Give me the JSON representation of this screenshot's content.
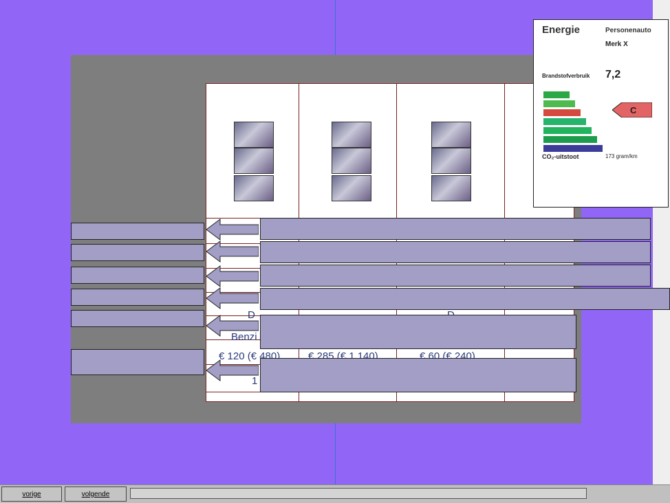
{
  "energy_label": {
    "title": "Energie",
    "category": "Personenauto",
    "brand": "Merk X",
    "efficiency_label": "Brandstofverbruik",
    "consumption": "7,2",
    "rating": "C",
    "co2_label": "CO₂-uitstoot",
    "co2_value": "173 gram/km"
  },
  "table": {
    "row_d": "D",
    "row_d_alt": "D",
    "fuel": "Benzi",
    "costs": [
      "€ 120 (€ 480)",
      "€ 285 (€ 1.140)",
      "€ 60 (€ 240)"
    ],
    "first_digit": "1"
  },
  "nav": {
    "prev_label": "vorige",
    "next_label": "volgende"
  },
  "colors": {
    "background": "#9166f6",
    "panel": "#7e7e7e",
    "box": "#a29ec6"
  }
}
